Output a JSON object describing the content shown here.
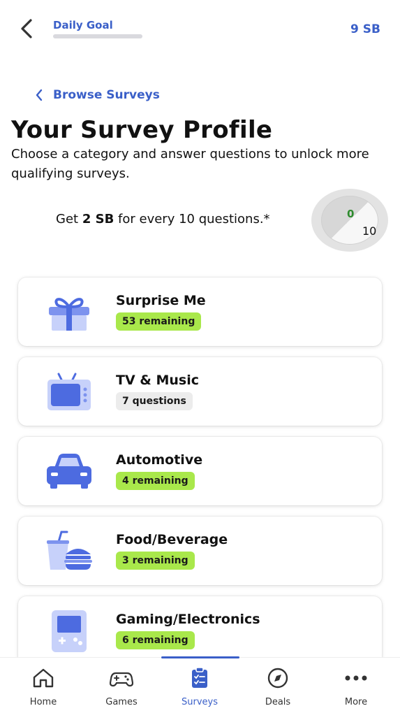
{
  "header": {
    "back_icon": "chevron-left-icon",
    "daily_goal_label": "Daily Goal",
    "daily_goal_progress": 0,
    "balance": "9 SB"
  },
  "nav": {
    "browse_label": "Browse Surveys"
  },
  "profile": {
    "title": "Your Survey Profile",
    "subtitle": "Choose a category and answer questions to unlock more qualifying surveys.",
    "reward_prefix": "Get ",
    "reward_amount": "2 SB",
    "reward_suffix": " for every 10 questions.*",
    "progress_current": "0",
    "progress_total": "10"
  },
  "categories": [
    {
      "name": "Surprise Me",
      "badge": "53 remaining",
      "badge_style": "green",
      "icon": "gift-icon"
    },
    {
      "name": "TV & Music",
      "badge": "7 questions",
      "badge_style": "grey",
      "icon": "tv-icon"
    },
    {
      "name": "Automotive",
      "badge": "4 remaining",
      "badge_style": "green",
      "icon": "car-icon"
    },
    {
      "name": "Food/Beverage",
      "badge": "3 remaining",
      "badge_style": "green",
      "icon": "food-drink-icon"
    },
    {
      "name": "Gaming/Electronics",
      "badge": "6 remaining",
      "badge_style": "green",
      "icon": "game-console-icon"
    }
  ],
  "tabs": [
    {
      "label": "Home",
      "icon": "home-icon"
    },
    {
      "label": "Games",
      "icon": "gamepad-icon"
    },
    {
      "label": "Surveys",
      "icon": "clipboard-check-icon",
      "active": true
    },
    {
      "label": "Deals",
      "icon": "compass-icon"
    },
    {
      "label": "More",
      "icon": "more-dots-icon"
    }
  ],
  "colors": {
    "accent": "#3a5fc8",
    "badge_green": "#a9e84b",
    "badge_grey": "#ececec",
    "icon_blue": "#4d6be0"
  }
}
